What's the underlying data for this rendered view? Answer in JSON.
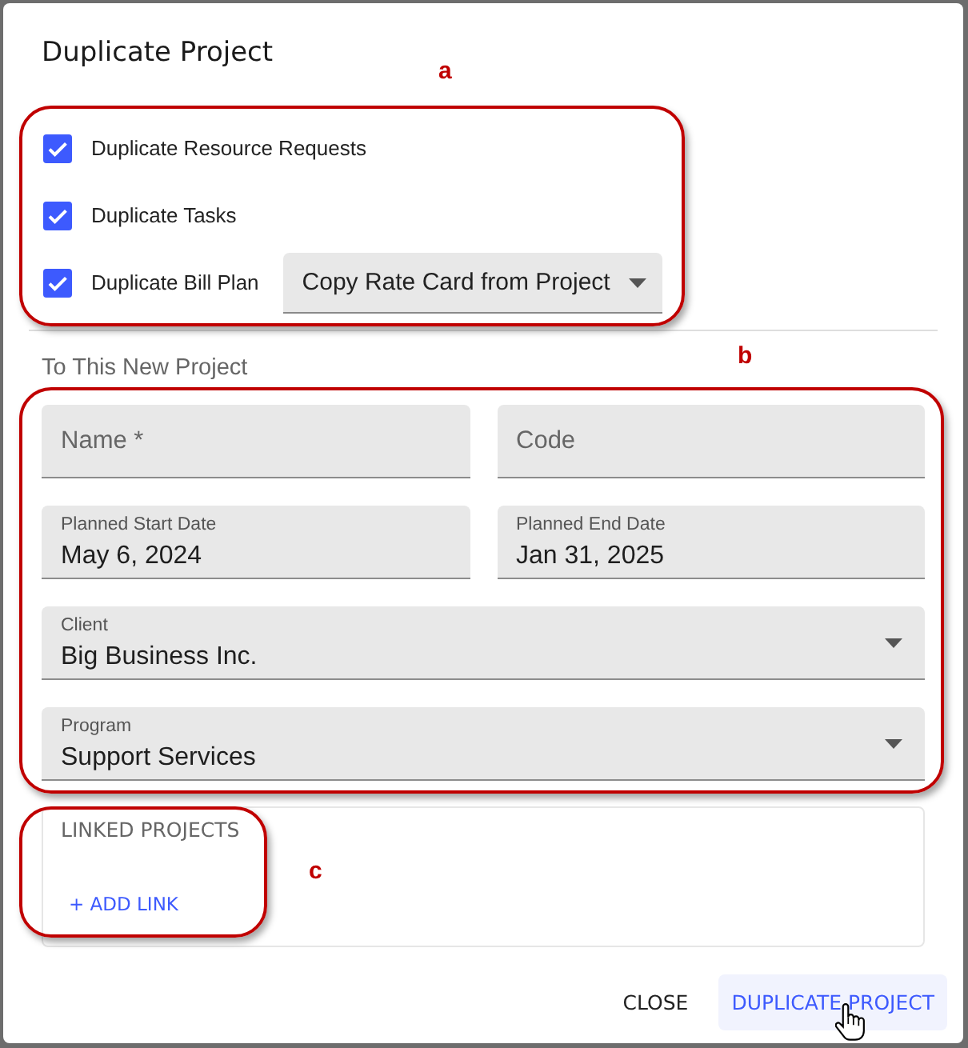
{
  "dialog": {
    "title": "Duplicate Project"
  },
  "options": {
    "annotation": "a",
    "items": [
      {
        "label": "Duplicate Resource Requests",
        "checked": true
      },
      {
        "label": "Duplicate Tasks",
        "checked": true
      },
      {
        "label": "Duplicate Bill Plan",
        "checked": true,
        "select": {
          "value": "Copy Rate Card from Project"
        }
      }
    ]
  },
  "new_project": {
    "heading": "To This New Project",
    "annotation": "b",
    "rows": [
      {
        "fields": [
          {
            "kind": "input",
            "placeholder": "Name *"
          },
          {
            "kind": "input",
            "placeholder": "Code"
          }
        ]
      },
      {
        "fields": [
          {
            "kind": "input",
            "label": "Planned Start Date",
            "value": "May 6, 2024"
          },
          {
            "kind": "input",
            "label": "Planned End Date",
            "value": "Jan 31, 2025"
          }
        ]
      },
      {
        "fields": [
          {
            "kind": "select",
            "label": "Client",
            "value": "Big Business Inc."
          }
        ]
      },
      {
        "fields": [
          {
            "kind": "select",
            "label": "Program",
            "value": "Support Services"
          }
        ]
      }
    ]
  },
  "linked_projects": {
    "heading": "LINKED PROJECTS",
    "annotation": "c",
    "add_link": "+ ADD LINK"
  },
  "buttons": [
    {
      "label": "CLOSE",
      "kind": "secondary",
      "hovered": false
    },
    {
      "label": "DUPLICATE PROJECT",
      "kind": "primary",
      "hovered": true
    }
  ]
}
